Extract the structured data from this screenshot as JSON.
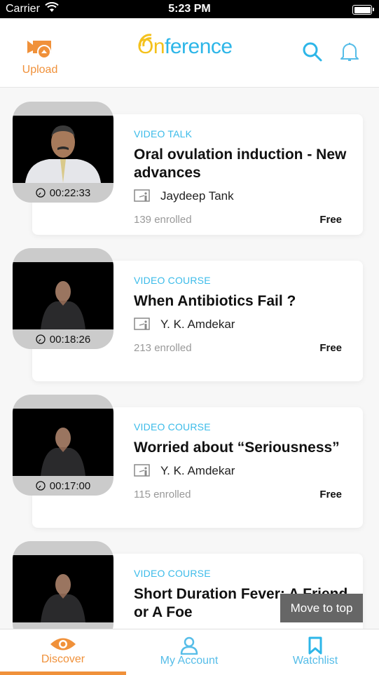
{
  "status_bar": {
    "carrier": "Carrier",
    "time": "5:23 PM"
  },
  "header": {
    "upload_label": "Upload",
    "logo_prefix": "On",
    "logo_suffix": "ference"
  },
  "courses": [
    {
      "type": "VIDEO TALK",
      "title": "Oral ovulation induction - New advances",
      "author": "Jaydeep Tank",
      "enrolled": "139 enrolled",
      "price": "Free",
      "duration": "00:22:33"
    },
    {
      "type": "VIDEO COURSE",
      "title": "When Antibiotics Fail ?",
      "author": "Y. K. Amdekar",
      "enrolled": "213 enrolled",
      "price": "Free",
      "duration": "00:18:26"
    },
    {
      "type": "VIDEO COURSE",
      "title": "Worried about “Seriousness”",
      "author": "Y. K. Amdekar",
      "enrolled": "115 enrolled",
      "price": "Free",
      "duration": "00:17:00"
    },
    {
      "type": "VIDEO COURSE",
      "title": "Short Duration Fever: A Friend or A Foe",
      "author": "",
      "enrolled": "",
      "price": "",
      "duration": ""
    }
  ],
  "move_to_top": "Move to top",
  "tabs": [
    {
      "label": "Discover",
      "icon": "eye-icon",
      "active": true
    },
    {
      "label": "My Account",
      "icon": "user-icon",
      "active": false
    },
    {
      "label": "Watchlist",
      "icon": "bookmark-icon",
      "active": false
    }
  ],
  "colors": {
    "accent_orange": "#f0913a",
    "brand_blue": "#2db6e8",
    "brand_yellow": "#f4c11c"
  }
}
